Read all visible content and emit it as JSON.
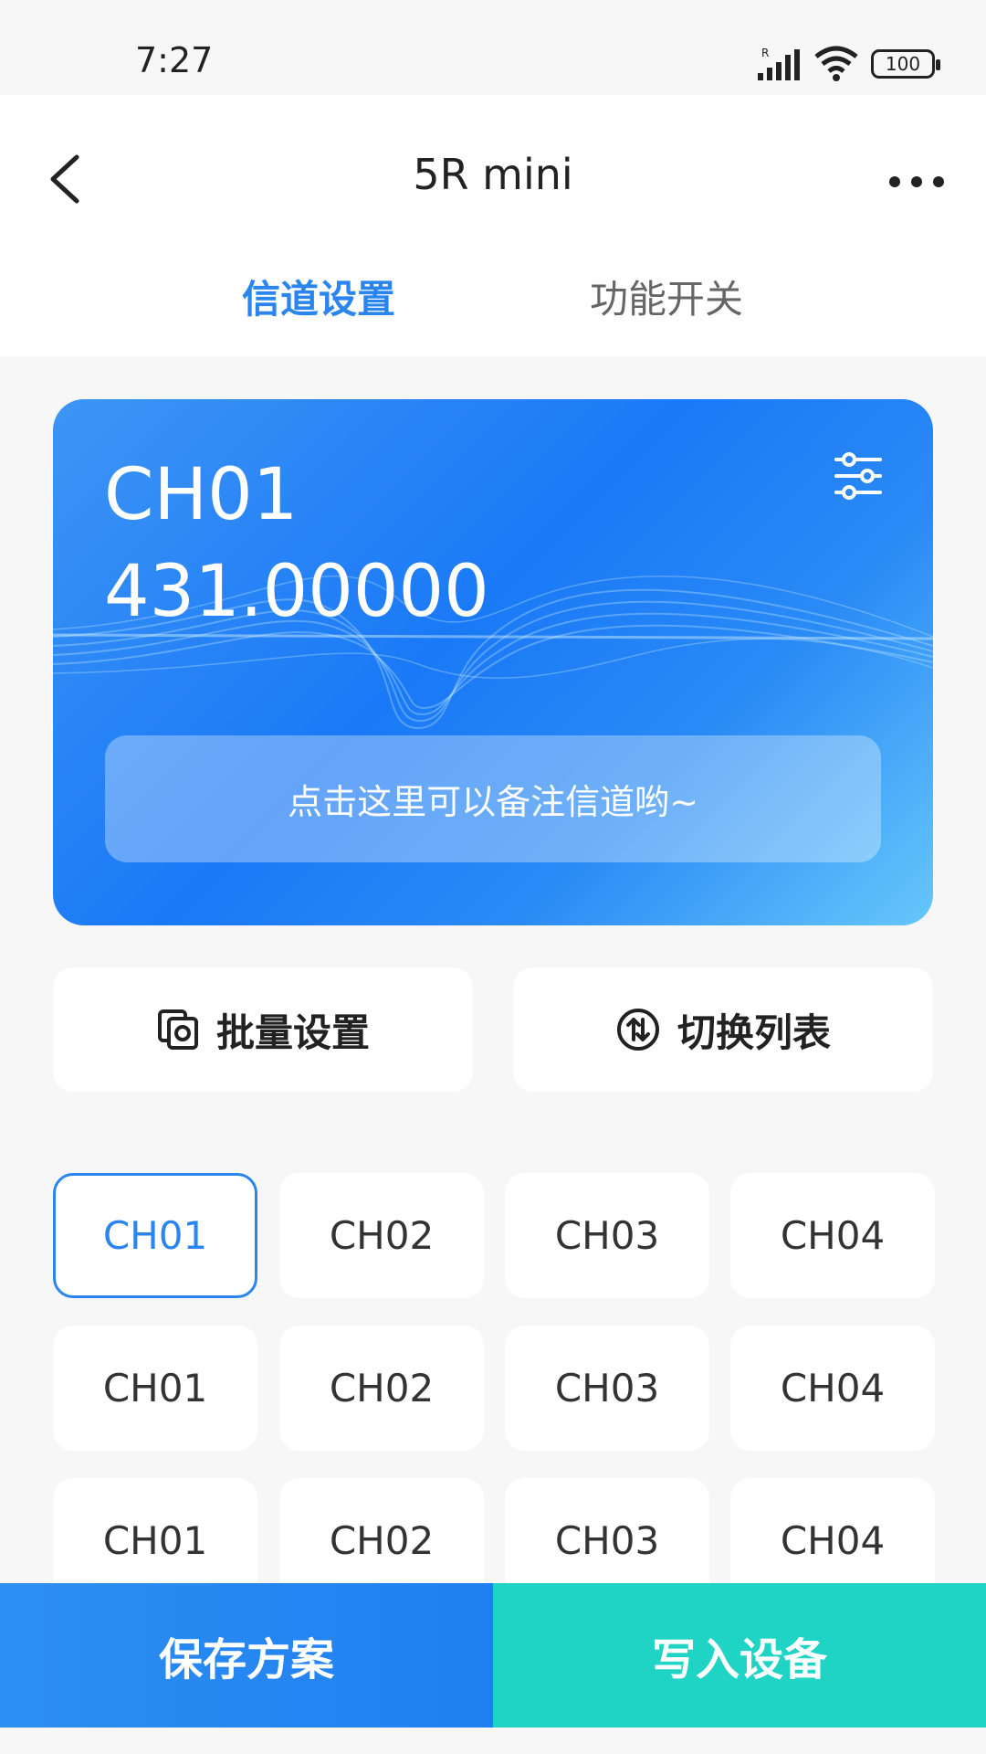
{
  "status_bar": {
    "time": "7:27",
    "battery": "100"
  },
  "header": {
    "title": "5R mini",
    "tabs": [
      {
        "label": "信道设置",
        "active": true
      },
      {
        "label": "功能开关",
        "active": false
      }
    ]
  },
  "card": {
    "channel": "CH01",
    "frequency": "431.00000",
    "note_placeholder": "点击这里可以备注信道哟~"
  },
  "actions": {
    "batch_label": "批量设置",
    "switch_label": "切换列表"
  },
  "channels": [
    [
      "CH01",
      "CH02",
      "CH03",
      "CH04"
    ],
    [
      "CH01",
      "CH02",
      "CH03",
      "CH04"
    ],
    [
      "CH01",
      "CH02",
      "CH03",
      "CH04"
    ]
  ],
  "bottom": {
    "save_label": "保存方案",
    "write_label": "写入设备"
  },
  "colors": {
    "accent": "#2a86ee",
    "teal": "#1fd3c5",
    "background": "#f7f7f7"
  }
}
